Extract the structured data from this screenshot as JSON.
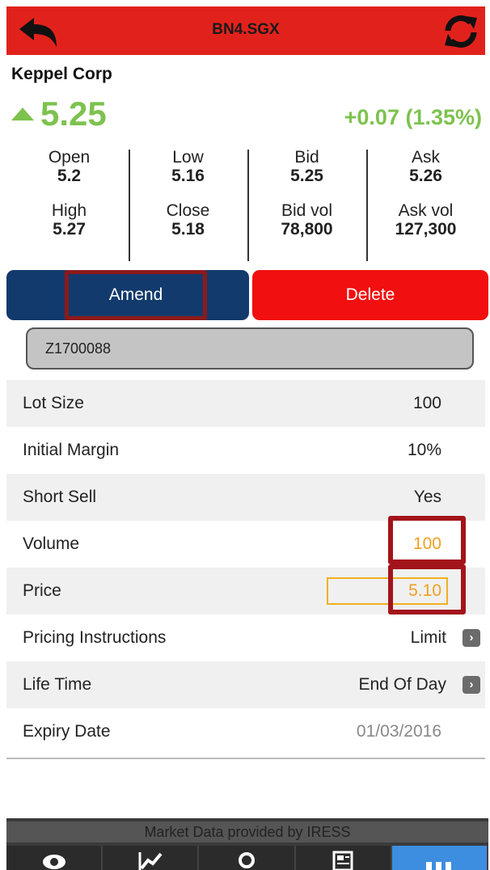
{
  "header": {
    "title": "BN4.SGX",
    "back_icon": "back-arrow-icon",
    "refresh_icon": "refresh-icon",
    "color": "#e1221c"
  },
  "quote": {
    "company": "Keppel Corp",
    "last_price": "5.25",
    "change": "+0.07 (1.35%)",
    "direction": "up",
    "up_color": "#7dc24f",
    "stats": [
      {
        "label1": "Open",
        "value1": "5.2",
        "label2": "High",
        "value2": "5.27"
      },
      {
        "label1": "Low",
        "value1": "5.16",
        "label2": "Close",
        "value2": "5.18"
      },
      {
        "label1": "Bid",
        "value1": "5.25",
        "label2": "Bid vol",
        "value2": "78,800"
      },
      {
        "label1": "Ask",
        "value1": "5.26",
        "label2": "Ask vol",
        "value2": "127,300"
      }
    ]
  },
  "actions": {
    "amend_label": "Amend",
    "delete_label": "Delete",
    "amend_color": "#123a6c",
    "delete_color": "#f20f0f"
  },
  "account": {
    "value": "Z1700088"
  },
  "order_fields": {
    "lot_size": {
      "label": "Lot Size",
      "value": "100"
    },
    "initial_margin": {
      "label": "Initial Margin",
      "value": "10%"
    },
    "short_sell": {
      "label": "Short Sell",
      "value": "Yes"
    },
    "volume": {
      "label": "Volume",
      "value": "100"
    },
    "price": {
      "label": "Price",
      "value": "5.10"
    },
    "pricing_instructions": {
      "label": "Pricing Instructions",
      "value": "Limit"
    },
    "life_time": {
      "label": "Life Time",
      "value": "End Of Day"
    },
    "expiry_date": {
      "label": "Expiry Date",
      "value": "01/03/2016"
    }
  },
  "footer": {
    "credit": "Market Data provided by IRESS",
    "tabs": [
      "watchlist-icon",
      "chart-icon",
      "search-icon",
      "news-icon",
      "more-icon"
    ],
    "active_tab": 4
  }
}
